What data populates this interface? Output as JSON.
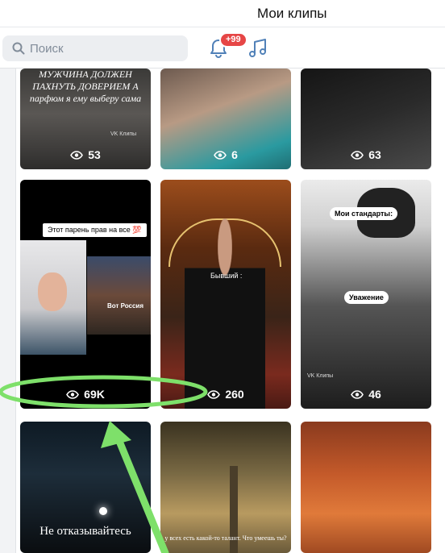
{
  "window": {
    "title": "Мои клипы"
  },
  "toolbar": {
    "search_placeholder": "Поиск",
    "search_icon": "search-icon",
    "notifications_icon": "bell-icon",
    "notifications_badge": "+99",
    "music_icon": "music-note-icon"
  },
  "clips": [
    {
      "views": "53",
      "overlay_text": "МУЖЧИНА ДОЛЖЕН ПАХНУТЬ ДОВЕРИЕМ А парфюм я ему выберу сама",
      "watermark": "VK Клипы"
    },
    {
      "views": "6"
    },
    {
      "views": "63"
    },
    {
      "views": "69K",
      "label": "Этот парень прав на все 💯",
      "caption": "Вот Россия"
    },
    {
      "views": "260",
      "label": "Бывший :"
    },
    {
      "views": "46",
      "label": "Мои стандарты:",
      "label2": "Уважение",
      "watermark": "VK Клипы"
    },
    {
      "overlay_text": "Не отказывайтесь"
    },
    {
      "overlay_text": "у всех есть какой-то талант. Что умеешь ты?"
    },
    {}
  ],
  "annotation": {
    "highlight_color": "#7ee06a",
    "highlighted_clip_views": "69K"
  },
  "colors": {
    "badge": "#e64646",
    "icon_blue": "#5181b8",
    "search_bg": "#eceef1"
  }
}
